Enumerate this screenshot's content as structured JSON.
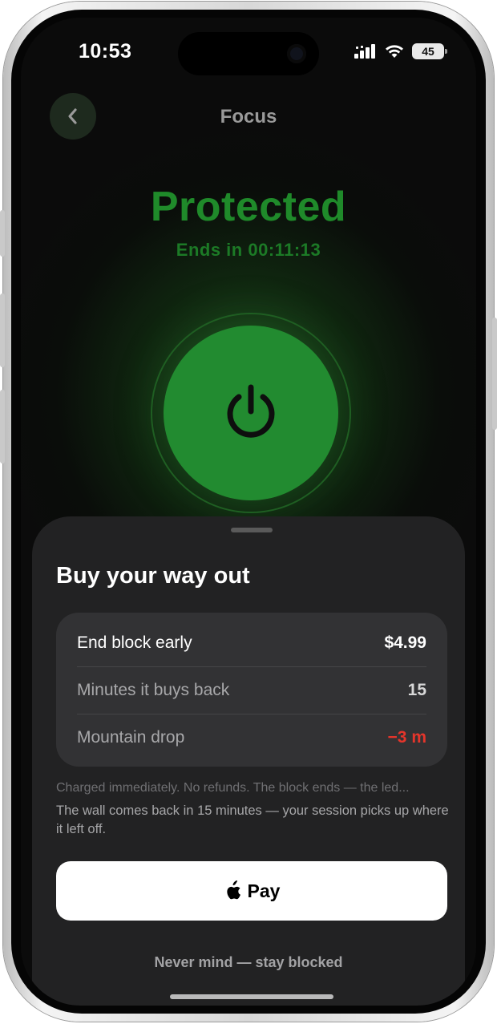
{
  "status_bar": {
    "time": "10:53",
    "battery": "45",
    "icons": [
      "cellular-signal-icon",
      "wifi-icon",
      "battery-icon"
    ]
  },
  "header": {
    "back_icon": "chevron-left-icon",
    "title": "Focus"
  },
  "status": {
    "title": "Protected",
    "subtitle": "Ends in 00:11:13",
    "color": "#1f8a2a",
    "power_icon": "power-icon"
  },
  "sheet": {
    "title": "Buy your way out",
    "rows": [
      {
        "label": "End block early",
        "value": "$4.99"
      },
      {
        "label": "Minutes it buys back",
        "value": "15"
      },
      {
        "label": "Mountain drop",
        "value": "−3 m"
      }
    ],
    "note_primary": "Charged immediately. No refunds. The block ends — the led...",
    "note_secondary": "The wall comes back in 15 minutes — your session picks up where it left off.",
    "pay_icon": "apple-logo-icon",
    "pay_label": "Pay",
    "cancel_label": "Never mind — stay blocked"
  },
  "colors": {
    "accent_green": "#228b30",
    "danger_red": "#e5352b",
    "sheet_bg": "#222223"
  }
}
